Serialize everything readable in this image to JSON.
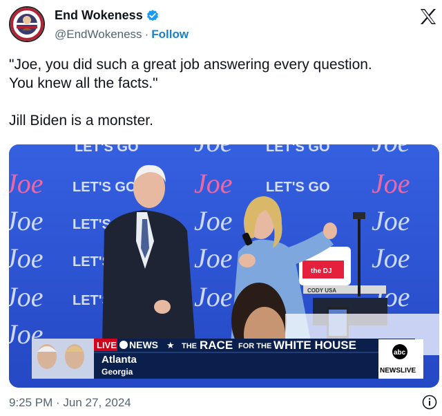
{
  "author": {
    "display_name": "End Wokeness",
    "handle": "@EndWokeness",
    "separator": "·",
    "follow_label": "Follow",
    "verified_icon": "verified-badge-icon",
    "avatar_text_top": "SUPPORT THE",
    "avatar_text_bottom": "FORMER TWITTER"
  },
  "platform_icon": "x-logo-icon",
  "tweet": {
    "text": "\"Joe, you did such a great job answering every question.\nYou knew all the facts.\"\n\nJill Biden is a monster."
  },
  "media": {
    "backdrop": {
      "slogan": "LET'S GO",
      "name": "Joe"
    },
    "lectern_sign": "the DJ",
    "lectern_brand": "CODY USA",
    "news_banner": {
      "live_label": "LIVE",
      "network": "NEWS",
      "star": "★",
      "program_pre": "THE",
      "program_main": "RACE",
      "program_mid": "FOR THE",
      "program_end": "WHITE HOUSE",
      "location_city": "Atlanta",
      "location_state": "Georgia",
      "logo_top": "abc",
      "logo_bottom": "NEWSLIVE"
    }
  },
  "footer": {
    "timestamp": "9:25 PM · Jun 27, 2024",
    "info_icon": "info-icon"
  },
  "colors": {
    "follow": "#1d7fc4",
    "verified": "#1d9bf0",
    "backdrop_blue": "#2f55d6",
    "joe_pink": "#ff6aa0",
    "banner_navy": "#0b1f4d",
    "live_red": "#d0021b"
  }
}
